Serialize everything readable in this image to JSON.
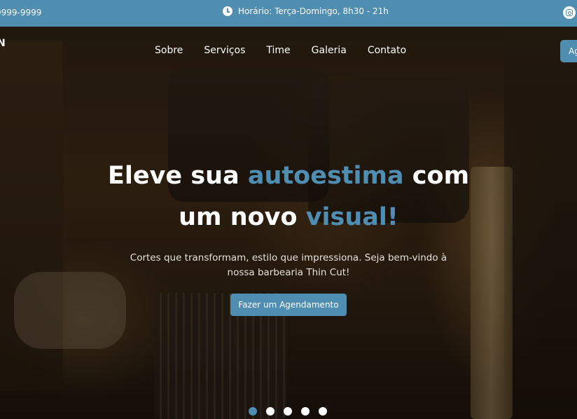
{
  "topbar": {
    "phone": "9999-9999",
    "hours": "Horário: Terça-Domingo, 8h30 - 21h",
    "icons": [
      "clock-icon",
      "instagram-icon"
    ]
  },
  "brand": {
    "fragment": "N"
  },
  "nav": {
    "items": [
      "Sobre",
      "Serviços",
      "Time",
      "Galeria",
      "Contato"
    ],
    "cta_label": "Ag"
  },
  "hero": {
    "line1_prefix": "Eleve sua ",
    "line1_accent": "autoestima",
    "line1_suffix": " com",
    "line2_prefix": "um novo ",
    "line2_accent": "visual!",
    "subtitle_line1": "Cortes que transformam, estilo que impressiona. Seja bem-vindo à",
    "subtitle_line2": "nossa barbearia Thin Cut!",
    "cta_label": "Fazer um Agendamento"
  },
  "carousel": {
    "total": 5,
    "active_index": 0
  },
  "colors": {
    "accent": "#4f8db1",
    "text": "#ffffff"
  }
}
